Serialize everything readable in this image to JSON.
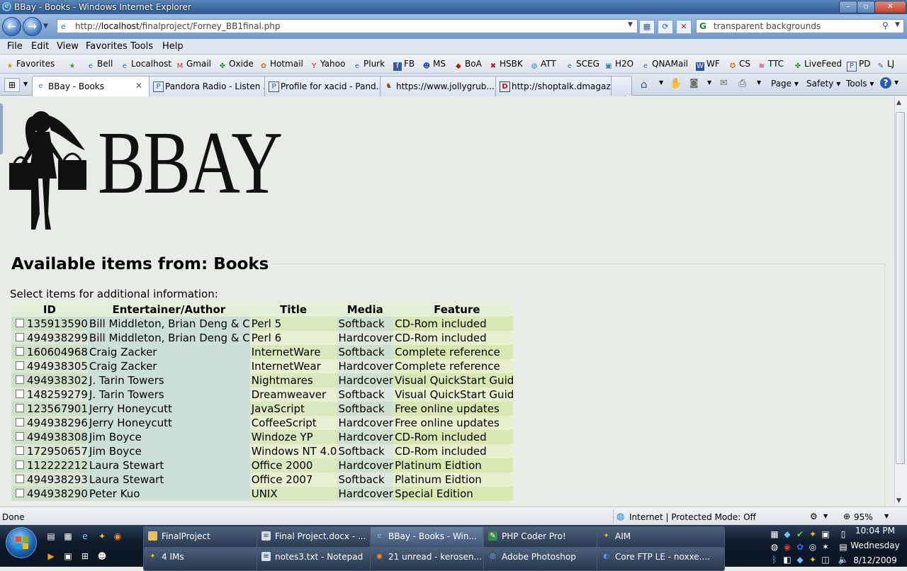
{
  "window": {
    "title": "BBay - Books - Windows Internet Explorer"
  },
  "nav": {
    "url_prefix": "http://",
    "url_host": "localhost",
    "url_path": "/finalproject/Forney_BB1final.php",
    "search_text": "transparent backgrounds"
  },
  "menu": [
    "File",
    "Edit",
    "View",
    "Favorites",
    "Tools",
    "Help"
  ],
  "favorites": {
    "label": "Favorites",
    "items": [
      "Bell",
      "Localhost",
      "Gmail",
      "Oxide",
      "Hotmail",
      "Yahoo",
      "Plurk",
      "FB",
      "MS",
      "BoA",
      "HSBK",
      "ATT",
      "SCEG",
      "H2O",
      "QNAMail",
      "WF",
      "CS",
      "TTC",
      "LiveFeed",
      "PD",
      "LJ"
    ]
  },
  "tabs": [
    {
      "label": "BBay - Books",
      "icon": "ie-page-icon"
    },
    {
      "label": "Pandora Radio - Listen ...",
      "icon": "pandora-icon"
    },
    {
      "label": "Profile for xacid - Pand...",
      "icon": "pandora-icon"
    },
    {
      "label": "https://www.jollygrub....",
      "icon": "dog-icon"
    },
    {
      "label": "http://shoptalk.dmagaz...",
      "icon": "d-icon"
    }
  ],
  "commands": {
    "page": "Page",
    "safety": "Safety",
    "tools": "Tools"
  },
  "page": {
    "logo_text": "BBAY",
    "title": "Available items from: Books",
    "instructions": "Select items for additional information:",
    "columns": [
      "ID",
      "Entertainer/Author",
      "Title",
      "Media",
      "Feature"
    ],
    "rows": [
      [
        "135913590",
        "Bill Middleton, Brian Deng & C",
        "Perl 5",
        "Softback",
        "CD-Rom included"
      ],
      [
        "494938299",
        "Bill Middleton, Brian Deng & C",
        "Perl 6",
        "Hardcover",
        "CD-Rom included"
      ],
      [
        "160604968",
        "Craig Zacker",
        "InternetWare",
        "Softback",
        "Complete reference"
      ],
      [
        "494938305",
        "Craig Zacker",
        "InternetWear",
        "Hardcover",
        "Complete reference"
      ],
      [
        "494938302",
        "J. Tarin Towers",
        "Nightmares",
        "Hardcover",
        "Visual QuickStart Guide"
      ],
      [
        "148259279",
        "J. Tarin Towers",
        "Dreamweaver",
        "Softback",
        "Visual QuickStart Guide"
      ],
      [
        "123567901",
        "Jerry Honeycutt",
        "JavaScript",
        "Softback",
        "Free online updates"
      ],
      [
        "494938296",
        "Jerry Honeycutt",
        "CoffeeScript",
        "Hardcover",
        "Free online updates"
      ],
      [
        "494938308",
        "Jim Boyce",
        "Windoze YP",
        "Hardcover",
        "CD-Rom included"
      ],
      [
        "172950657",
        "Jim Boyce",
        "Windows NT 4.0",
        "Softback",
        "CD-Rom included"
      ],
      [
        "112222212",
        "Laura Stewart",
        "Office 2000",
        "Hardcover",
        "Platinum Eidtion"
      ],
      [
        "494938293",
        "Laura Stewart",
        "Office 2007",
        "Softback",
        "Platinum Eidtion"
      ],
      [
        "494938290",
        "Peter Kuo",
        "UNIX",
        "Hardcover",
        "Special Edition"
      ]
    ]
  },
  "status": {
    "left": "Done",
    "zone": "Internet | Protected Mode: Off",
    "zoom": "95%"
  },
  "taskbar": {
    "top_row": [
      "FinalProject",
      "Final Project.docx - ...",
      "BBay - Books - Win...",
      "PHP Coder Pro!",
      "AIM"
    ],
    "bottom_row": [
      "4 IMs",
      "notes3.txt - Notepad",
      "21 unread - kerosen...",
      "Adobe Photoshop",
      "Core FTP LE - noxxe...."
    ],
    "clock_time": "10:04 PM",
    "clock_day": "Wednesday",
    "clock_date": "8/12/2009"
  },
  "colors": {
    "title_bar": "#3c6aa0",
    "page_bg": "#e8ece6",
    "table_header": "#e3efd6"
  }
}
